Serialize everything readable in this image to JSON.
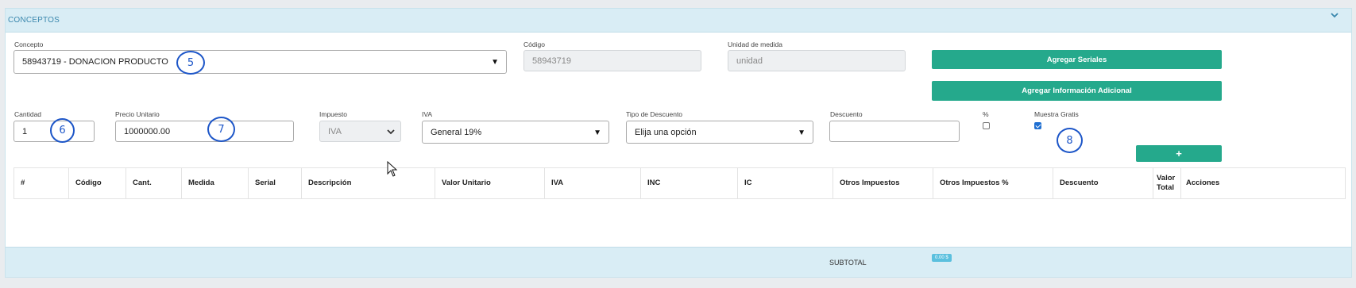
{
  "panel": {
    "title": "CONCEPTOS"
  },
  "form": {
    "concepto": {
      "label": "Concepto",
      "value": "58943719 - DONACION PRODUCTO"
    },
    "codigo": {
      "label": "Código",
      "value": "58943719"
    },
    "unidad": {
      "label": "Unidad de medida",
      "value": "unidad"
    },
    "cantidad": {
      "label": "Cantidad",
      "value": "1"
    },
    "precio": {
      "label": "Precio Unitario",
      "value": "1000000.00"
    },
    "impuesto": {
      "label": "Impuesto",
      "value": "IVA"
    },
    "iva": {
      "label": "IVA",
      "value": "General 19%"
    },
    "tipo_descuento": {
      "label": "Tipo de Descuento",
      "value": "Elija una opción"
    },
    "descuento": {
      "label": "Descuento",
      "value": ""
    },
    "porcentaje": {
      "label": "%",
      "checked": false
    },
    "muestra_gratis": {
      "label": "Muestra Gratis",
      "checked": true
    }
  },
  "buttons": {
    "agregar_seriales": "Agregar Seriales",
    "agregar_info": "Agregar Información Adicional",
    "add": "+"
  },
  "annotations": [
    "5",
    "6",
    "7",
    "8"
  ],
  "table": {
    "columns": [
      "#",
      "Código",
      "Cant.",
      "Medida",
      "Serial",
      "Descripción",
      "Valor Unitario",
      "IVA",
      "INC",
      "IC",
      "Otros Impuestos",
      "Otros Impuestos %",
      "Descuento",
      "Valor Total",
      "Acciones"
    ],
    "rows": []
  },
  "footer": {
    "subtotal_label": "SUBTOTAL",
    "subtotal_value": "0.00 $"
  },
  "colors": {
    "accent": "#25a98c",
    "header_bg": "#d9edf5",
    "title": "#3a87ad",
    "annotation": "#1d56c8"
  }
}
